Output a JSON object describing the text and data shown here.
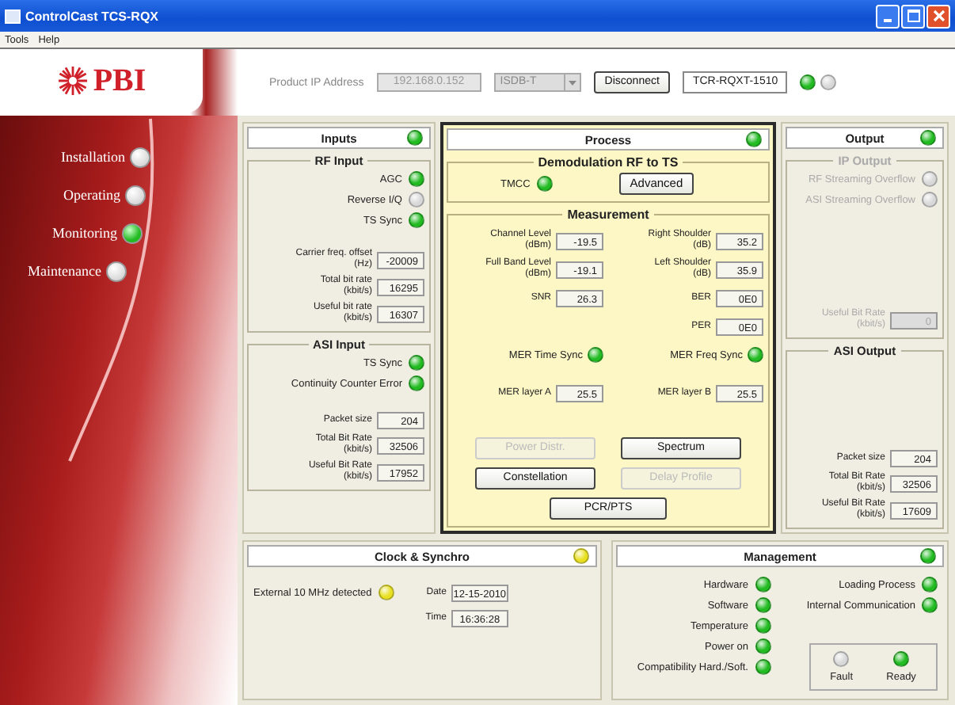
{
  "window": {
    "title": "ControlCast TCS-RQX"
  },
  "menu": [
    "Tools",
    "Help"
  ],
  "header": {
    "logo": "PBI",
    "ip_label": "Product IP Address",
    "ip_value": "192.168.0.152",
    "ip_disabled": true,
    "standard": "ISDB-T",
    "standard_disabled": true,
    "connect_button": "Disconnect",
    "device": "TCR-RQXT-1510",
    "leds": [
      {
        "color": "#22bb22"
      },
      {
        "color": "#d8d8d8"
      }
    ]
  },
  "nav": [
    {
      "label": "Installation",
      "selected": false
    },
    {
      "label": "Operating",
      "selected": false
    },
    {
      "label": "Monitoring",
      "selected": true
    },
    {
      "label": "Maintenance",
      "selected": false
    }
  ],
  "inputs": {
    "title": "Inputs",
    "color": "#22bb22",
    "sections": [
      {
        "title": "RF Input",
        "disabled": false,
        "items": [
          {
            "kind": "led",
            "label": "AGC",
            "color": "#22bb22"
          },
          {
            "kind": "led",
            "label": "Reverse I/Q",
            "color": "#d8d8d8"
          },
          {
            "kind": "led",
            "label": "TS Sync",
            "color": "#22bb22"
          },
          {
            "kind": "field",
            "label": "Carrier freq. offset",
            "unit": "(Hz)",
            "value": "-20009"
          },
          {
            "kind": "field",
            "label": "Total bit rate",
            "unit": "(kbit/s)",
            "value": "16295"
          },
          {
            "kind": "field",
            "label": "Useful bit rate",
            "unit": "(kbit/s)",
            "value": "16307"
          }
        ]
      },
      {
        "title": "ASI Input",
        "disabled": false,
        "items": [
          {
            "kind": "led",
            "label": "TS Sync",
            "color": "#22bb22"
          },
          {
            "kind": "led",
            "label": "Continuity Counter Error",
            "color": "#22bb22"
          },
          {
            "kind": "field",
            "label": "Packet size",
            "value": "204"
          },
          {
            "kind": "field",
            "label": "Total Bit Rate",
            "unit": "(kbit/s)",
            "value": "32506"
          },
          {
            "kind": "field",
            "label": "Useful Bit Rate",
            "unit": "(kbit/s)",
            "value": "17952"
          }
        ]
      }
    ]
  },
  "process": {
    "title": "Process",
    "color": "#22bb22",
    "demodulation": {
      "title": "Demodulation RF to TS",
      "label": "TMCC",
      "color": "#22bb22",
      "button": "Advanced"
    },
    "measurement": {
      "title": "Measurement",
      "rows": [
        {
          "left": {
            "kind": "field",
            "label": "Channel Level",
            "unit": "(dBm)",
            "value": "-19.5"
          },
          "right": {
            "kind": "field",
            "label": "Right Shoulder",
            "unit": "(dB)",
            "value": "35.2"
          }
        },
        {
          "left": {
            "kind": "field",
            "label": "Full Band Level",
            "unit": "(dBm)",
            "value": "-19.1"
          },
          "right": {
            "kind": "field",
            "label": "Left Shoulder",
            "unit": "(dB)",
            "value": "35.9"
          }
        },
        {
          "left": {
            "kind": "field",
            "label": "SNR",
            "value": "26.3"
          },
          "right": {
            "kind": "field",
            "label": "BER",
            "value": "0E0"
          }
        },
        {
          "right": {
            "kind": "field",
            "label": "PER",
            "value": "0E0"
          }
        },
        {
          "left": {
            "kind": "led",
            "label": "MER Time Sync",
            "color": "#22bb22"
          },
          "right": {
            "kind": "led",
            "label": "MER Freq Sync",
            "color": "#22bb22"
          }
        },
        {
          "left": {
            "kind": "field",
            "label": "MER layer A",
            "value": "25.5"
          },
          "right": {
            "kind": "field",
            "label": "MER layer B",
            "value": "25.5"
          }
        }
      ],
      "buttons": [
        {
          "label": "Power Distr.",
          "disabled": true
        },
        {
          "label": "Spectrum",
          "disabled": false
        },
        {
          "label": "Constellation",
          "disabled": false
        },
        {
          "label": "Delay Profile",
          "disabled": true
        },
        {
          "label": "PCR/PTS",
          "disabled": false
        }
      ]
    }
  },
  "output": {
    "title": "Output",
    "color": "#22bb22",
    "sections": [
      {
        "title": "IP Output",
        "disabled": true,
        "items": [
          {
            "kind": "led",
            "label": "RF Streaming Overflow",
            "color": "#d8d8d8"
          },
          {
            "kind": "led",
            "label": "ASI Streaming Overflow",
            "color": "#d8d8d8"
          },
          {
            "kind": "field",
            "label": "Useful Bit Rate",
            "unit": "(kbit/s)",
            "value": "0"
          }
        ]
      },
      {
        "title": "ASI Output",
        "disabled": false,
        "items": [
          {
            "kind": "field",
            "label": "Packet size",
            "value": "204"
          },
          {
            "kind": "field",
            "label": "Total Bit Rate",
            "unit": "(kbit/s)",
            "value": "32506"
          },
          {
            "kind": "field",
            "label": "Useful Bit Rate",
            "unit": "(kbit/s)",
            "value": "17609"
          }
        ]
      }
    ]
  },
  "clock": {
    "title": "Clock & Synchro",
    "color": "#e8e020",
    "indicator": {
      "label": "External 10 MHz detected",
      "color": "#e8e020"
    },
    "date_label": "Date",
    "date": "12-15-2010",
    "time_label": "Time",
    "time": "16:36:28"
  },
  "management": {
    "title": "Management",
    "color": "#22bb22",
    "left": [
      {
        "label": "Hardware",
        "color": "#22bb22"
      },
      {
        "label": "Software",
        "color": "#22bb22"
      },
      {
        "label": "Temperature",
        "color": "#22bb22"
      },
      {
        "label": "Power on",
        "color": "#22bb22"
      },
      {
        "label": "Compatibility Hard./Soft.",
        "color": "#22bb22"
      }
    ],
    "right": [
      {
        "label": "Loading Process",
        "color": "#22bb22"
      },
      {
        "label": "Internal Communication",
        "color": "#22bb22"
      }
    ],
    "status": [
      {
        "label": "Fault",
        "color": "#d8d8d8"
      },
      {
        "label": "Ready",
        "color": "#22bb22"
      }
    ]
  }
}
